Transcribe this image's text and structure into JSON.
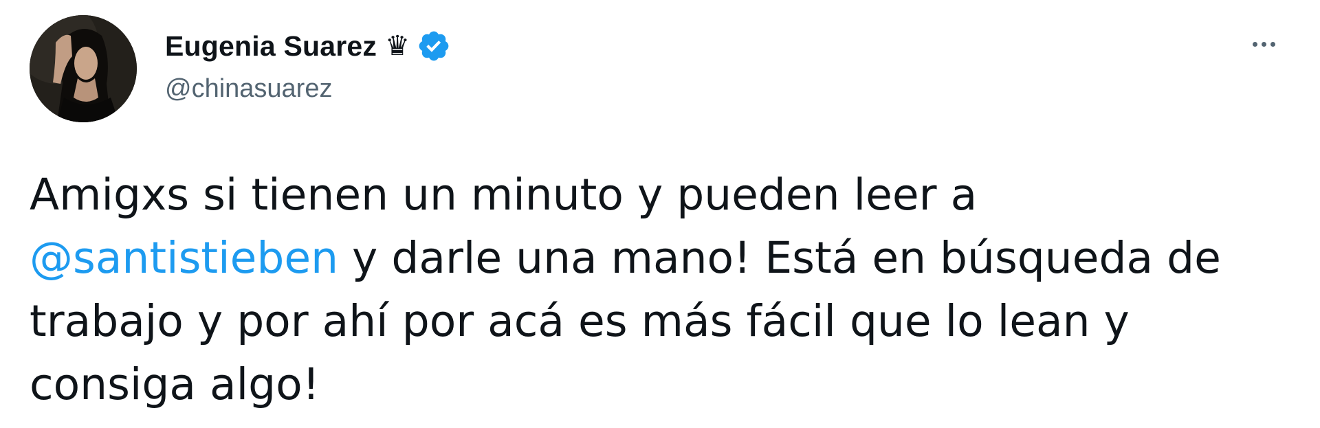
{
  "tweet": {
    "author": {
      "display_name": "Eugenia Suarez",
      "crown_glyph": "♛",
      "handle": "@chinasuarez",
      "verified": true,
      "avatar_icon": "profile-photo"
    },
    "more_icon": "more-horizontal-icon",
    "text_lines": [
      {
        "before": "Amigxs si tienen un minuto y pueden leer a",
        "mention": "",
        "after": ""
      },
      {
        "before": "",
        "mention": "@santistieben",
        "after": " y darle una mano! Está en búsqueda de"
      },
      {
        "before": "trabajo y por ahí por acá es más fácil que lo lean y",
        "mention": "",
        "after": ""
      },
      {
        "before": "consiga algo!",
        "mention": "",
        "after": ""
      }
    ]
  },
  "colors": {
    "text": "#0f1419",
    "secondary": "#536471",
    "link": "#1d9bf0",
    "verified": "#1d9bf0"
  }
}
